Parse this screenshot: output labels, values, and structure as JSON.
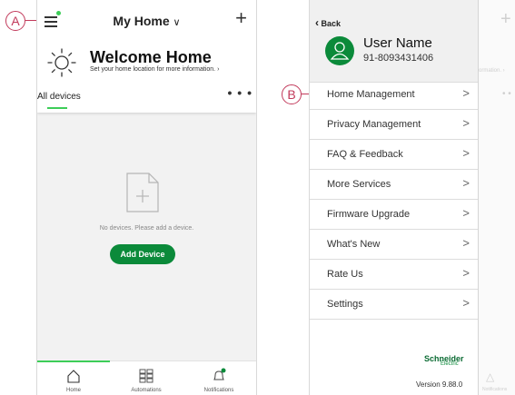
{
  "callouts": {
    "a": "A",
    "b": "B"
  },
  "home_screen": {
    "title": "My Home",
    "title_chevron": "∨",
    "plus": "+",
    "welcome_title": "Welcome Home",
    "welcome_subtitle": "Set your home location for more information. ›",
    "all_devices": "All devices",
    "more": "• • •",
    "empty_text": "No devices. Please add a device.",
    "add_device": "Add Device",
    "tabs": [
      {
        "label": "Home",
        "icon": "house-icon"
      },
      {
        "label": "Automations",
        "icon": "grid-icon"
      },
      {
        "label": "Notifications",
        "icon": "bell-icon"
      }
    ]
  },
  "drawer": {
    "back": "Back",
    "back_chevron": "‹",
    "user_name": "User Name",
    "user_phone": "91-8093431406",
    "menu": [
      {
        "label": "Home Management"
      },
      {
        "label": "Privacy Management"
      },
      {
        "label": "FAQ & Feedback"
      },
      {
        "label": "More Services"
      },
      {
        "label": "Firmware Upgrade"
      },
      {
        "label": "What's New"
      },
      {
        "label": "Rate Us"
      },
      {
        "label": "Settings"
      }
    ],
    "menu_chevron": ">",
    "logo_text": "Schneider",
    "logo_sub": "Electric",
    "version": "Version 9.88.0"
  },
  "behind": {
    "plus": "+",
    "info": "ormation. ›",
    "notifications": "Notifications"
  },
  "colors": {
    "accent": "#3dcd58",
    "brand": "#0b8a3a",
    "callout": "#c23a5b"
  }
}
